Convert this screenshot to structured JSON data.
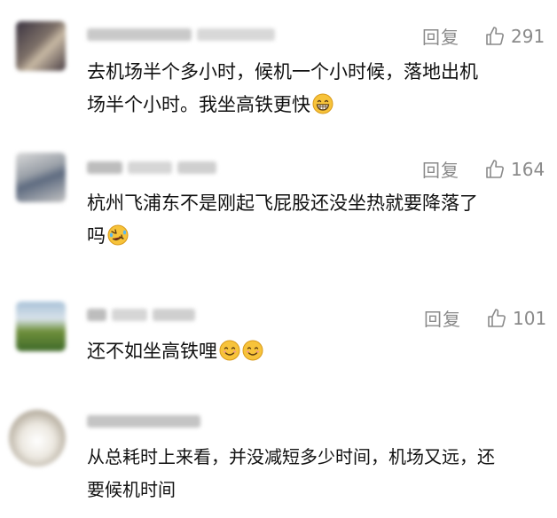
{
  "reply_label": "回复",
  "comments": [
    {
      "likes": "291",
      "text_line1": "去机场半个多小时，候机一个小时候，落地出机",
      "text_line2": "场半个小时。我坐高铁更快",
      "emoji": "grinning-face-icon"
    },
    {
      "likes": "164",
      "text_line1": "杭州飞浦东不是刚起飞屁股还没坐热就要降落了",
      "text_line2": "吗",
      "emoji": "rolling-laughing-face-icon"
    },
    {
      "likes": "101",
      "text_line1": "还不如坐高铁哩",
      "emoji": "smiling-face-icon"
    },
    {
      "text_line1": "从总耗时上来看，并没减短多少时间，机场又远，还",
      "text_line2": "要候机时间"
    }
  ],
  "colors": {
    "text": "#111111",
    "meta": "#8a8a8a",
    "emoji_yellow": "#f7c33a"
  }
}
